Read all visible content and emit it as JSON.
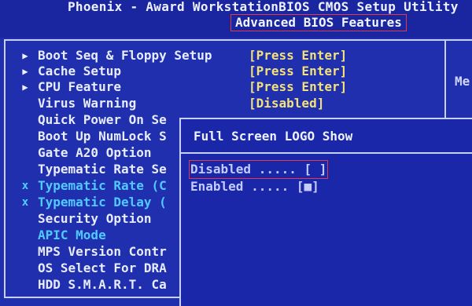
{
  "header": {
    "bios_title": "Phoenix - Award WorkstationBIOS CMOS Setup Utility",
    "section_title": "Advanced BIOS Features"
  },
  "help_panel": {
    "label": "Me"
  },
  "menu": {
    "items": [
      {
        "marker": "▶",
        "label": "Boot Seq & Floppy Setup",
        "value": "[Press Enter]",
        "dim": false
      },
      {
        "marker": "▶",
        "label": "Cache Setup",
        "value": "[Press Enter]",
        "dim": false
      },
      {
        "marker": "▶",
        "label": "CPU Feature",
        "value": "[Press Enter]",
        "dim": false
      },
      {
        "marker": "",
        "label": "Virus Warning",
        "value": "[Disabled]",
        "dim": false
      },
      {
        "marker": "",
        "label": "Quick Power On Se",
        "value": "",
        "dim": false
      },
      {
        "marker": "",
        "label": "Boot Up NumLock S",
        "value": "",
        "dim": false
      },
      {
        "marker": "",
        "label": "Gate A20 Option",
        "value": "",
        "dim": false
      },
      {
        "marker": "",
        "label": "Typematic Rate Se",
        "value": "",
        "dim": false
      },
      {
        "marker": "x",
        "label": "Typematic Rate (C",
        "value": "",
        "dim": true
      },
      {
        "marker": "x",
        "label": "Typematic Delay (",
        "value": "",
        "dim": true
      },
      {
        "marker": "",
        "label": "Security Option",
        "value": "",
        "dim": false
      },
      {
        "marker": "",
        "label": "APIC Mode",
        "value": "",
        "dim": true
      },
      {
        "marker": "",
        "label": "MPS Version Contr",
        "value": "",
        "dim": false
      },
      {
        "marker": "",
        "label": "OS Select For DRA",
        "value": "",
        "dim": false
      },
      {
        "marker": "",
        "label": "HDD S.M.A.R.T. Ca",
        "value": "",
        "dim": false
      }
    ]
  },
  "popup": {
    "title": "Full Screen LOGO Show",
    "options": [
      {
        "text": "Disabled ..... [ ]",
        "selected": false,
        "highlighted": true
      },
      {
        "text": "Enabled  ..... [■]",
        "selected": true,
        "highlighted": false
      }
    ]
  },
  "colors": {
    "background": "#1f2fae",
    "text": "#e8ecff",
    "value": "#f3e27a",
    "dim_text": "#52c9ff",
    "highlight_border": "#e23a4a"
  }
}
